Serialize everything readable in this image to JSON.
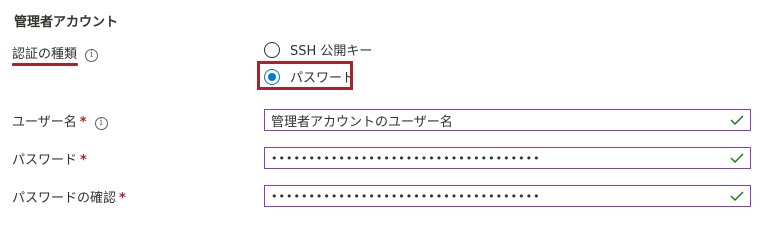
{
  "section_title": "管理者アカウント",
  "auth_type": {
    "label": "認証の種類",
    "options": [
      {
        "label": "SSH 公開キー",
        "checked": false
      },
      {
        "label": "パスワード",
        "checked": true
      }
    ]
  },
  "username": {
    "label": "ユーザー名",
    "required_mark": "*",
    "value": "管理者アカウントのユーザー名"
  },
  "password": {
    "label": "パスワード",
    "required_mark": "*",
    "value": "••••••••••••••••••••••••••••••••••••"
  },
  "password_confirm": {
    "label": "パスワードの確認",
    "required_mark": "*",
    "value": "••••••••••••••••••••••••••••••••••••"
  },
  "colors": {
    "accent": "#0078d4",
    "highlight": "#a4262c",
    "valid": "#107c10",
    "field_border": "#8a3cbf"
  }
}
